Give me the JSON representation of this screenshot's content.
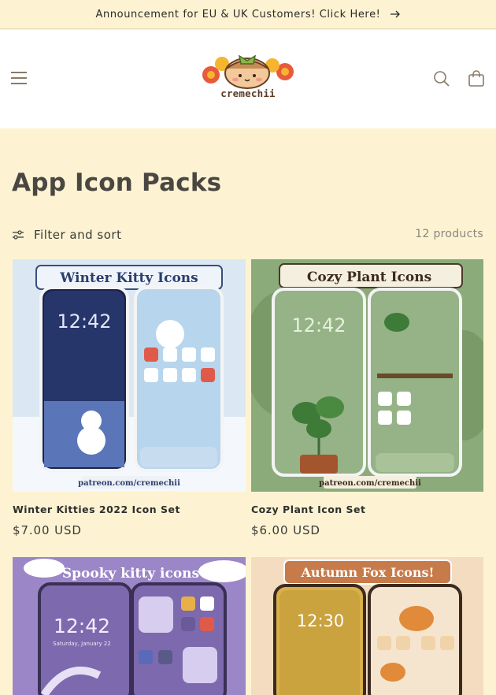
{
  "announcement": {
    "text": "Announcement for EU & UK Customers! Click Here!"
  },
  "header": {
    "logo_text": "cremechii"
  },
  "collection": {
    "title": "App Icon Packs",
    "filter_label": "Filter and sort",
    "product_count": "12 products"
  },
  "products": [
    {
      "title": "Winter Kitties 2022 Icon Set",
      "price": "$7.00 USD",
      "banner": "Winter Kitty Icons",
      "clock": "12:42",
      "footer": "patreon.com/cremechii"
    },
    {
      "title": "Cozy Plant Icon Set",
      "price": "$6.00 USD",
      "banner": "Cozy Plant Icons",
      "clock": "12:42",
      "footer": "patreon.com/cremechii"
    },
    {
      "banner": "Spooky kitty icons",
      "clock": "12:42",
      "date": "Saturday, January 22"
    },
    {
      "banner": "Autumn Fox Icons!",
      "clock": "12:30"
    }
  ],
  "colors": {
    "background": "#fdf3d2",
    "header_bg": "#ffffff",
    "icon_color": "#8a7a68",
    "heading": "#4a4642"
  }
}
